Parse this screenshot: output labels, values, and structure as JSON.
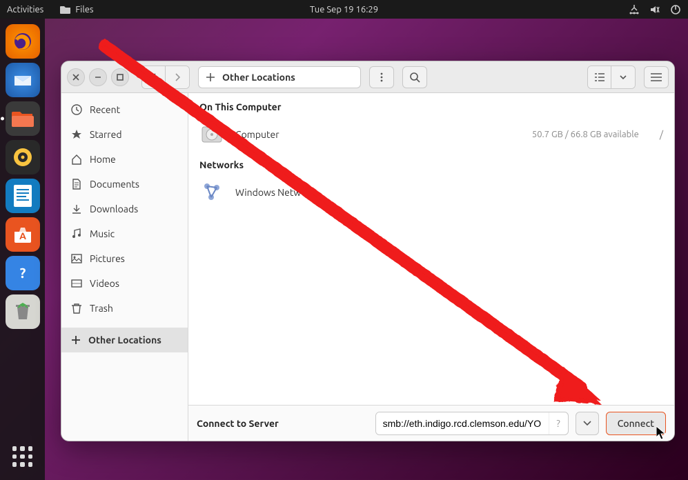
{
  "topbar": {
    "activities": "Activities",
    "app_name": "Files",
    "datetime": "Tue Sep 19  16:29"
  },
  "dock": {
    "items": [
      "firefox",
      "thunderbird",
      "files",
      "rhythmbox",
      "libreoffice-writer",
      "software",
      "help",
      "trash"
    ]
  },
  "window": {
    "path_label": "Other Locations"
  },
  "sidebar": {
    "items": [
      {
        "label": "Recent",
        "icon": "clock-icon"
      },
      {
        "label": "Starred",
        "icon": "star-icon"
      },
      {
        "label": "Home",
        "icon": "home-icon"
      },
      {
        "label": "Documents",
        "icon": "document-icon"
      },
      {
        "label": "Downloads",
        "icon": "download-icon"
      },
      {
        "label": "Music",
        "icon": "music-icon"
      },
      {
        "label": "Pictures",
        "icon": "picture-icon"
      },
      {
        "label": "Videos",
        "icon": "video-icon"
      },
      {
        "label": "Trash",
        "icon": "trash-icon"
      },
      {
        "label": "Other Locations",
        "icon": "plus-icon"
      }
    ]
  },
  "main": {
    "section_computer": "On This Computer",
    "computer_label": "Computer",
    "computer_meta": "50.7 GB / 66.8 GB available",
    "computer_mount": "/",
    "section_networks": "Networks",
    "network_label": "Windows Network"
  },
  "connect": {
    "label": "Connect to Server",
    "value": "smb://eth.indigo.rcd.clemson.edu/YO",
    "button": "Connect"
  }
}
